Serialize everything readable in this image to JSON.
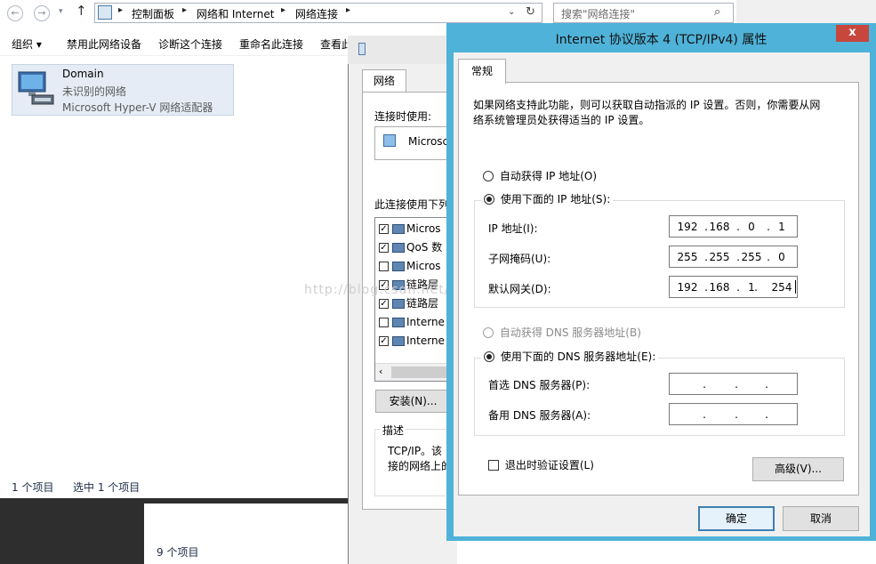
{
  "explorer": {
    "breadcrumb": [
      "控制面板",
      "网络和 Internet",
      "网络连接"
    ],
    "search_placeholder": "搜索\"网络连接\"",
    "toolbar": [
      "组织 ▾",
      "禁用此网络设备",
      "诊断这个连接",
      "重命名此连接",
      "查看此"
    ],
    "adapter": {
      "name": "Domain",
      "status": "未识别的网络",
      "device": "Microsoft Hyper-V 网络适配器"
    },
    "status": {
      "count": "1 个项目",
      "selected": "选中 1 个项目"
    }
  },
  "second_window": {
    "count": "9 个项目"
  },
  "network_dialog": {
    "tab": "网络",
    "connect_using_label": "连接时使用:",
    "adapter_truncated": "Microsc",
    "items_label": "此连接使用下列",
    "items": [
      {
        "checked": true,
        "text": "Micros"
      },
      {
        "checked": true,
        "text": "QoS 数"
      },
      {
        "checked": false,
        "text": "Micros"
      },
      {
        "checked": true,
        "text": "链路层"
      },
      {
        "checked": true,
        "text": "链路层"
      },
      {
        "checked": false,
        "text": "Interne"
      },
      {
        "checked": true,
        "text": "Interne"
      }
    ],
    "install_button": "安装(N)...",
    "description_title": "描述",
    "description_line1": "TCP/IP。该",
    "description_line2": "接的网络上的"
  },
  "ipv4_dialog": {
    "title": "Internet 协议版本 4 (TCP/IPv4) 属性",
    "close_label": "x",
    "tab": "常规",
    "intro_line1": "如果网络支持此功能，则可以获取自动指派的 IP 设置。否则，你需要从网",
    "intro_line2": "络系统管理员处获得适当的 IP 设置。",
    "auto_ip_label": "自动获得 IP 地址(O)",
    "manual_ip_label": "使用下面的 IP 地址(S):",
    "ip_label": "IP 地址(I):",
    "ip": [
      "192",
      "168",
      "0",
      "1"
    ],
    "mask_label": "子网掩码(U):",
    "mask": [
      "255",
      "255",
      "255",
      "0"
    ],
    "gateway_label": "默认网关(D):",
    "gateway": [
      "192",
      "168",
      "1",
      "254"
    ],
    "auto_dns_label": "自动获得 DNS 服务器地址(B)",
    "manual_dns_label": "使用下面的 DNS 服务器地址(E):",
    "preferred_dns_label": "首选 DNS 服务器(P):",
    "alternate_dns_label": "备用 DNS 服务器(A):",
    "validate_label": "退出时验证设置(L)",
    "advanced_button": "高级(V)...",
    "ok_button": "确定",
    "cancel_button": "取消"
  },
  "watermark": "http://blog.csdn.net/hhl_huangzj",
  "colors": {
    "frame": "#4fb2d8",
    "close": "#c7473d",
    "selection": "#e5ecf5"
  }
}
